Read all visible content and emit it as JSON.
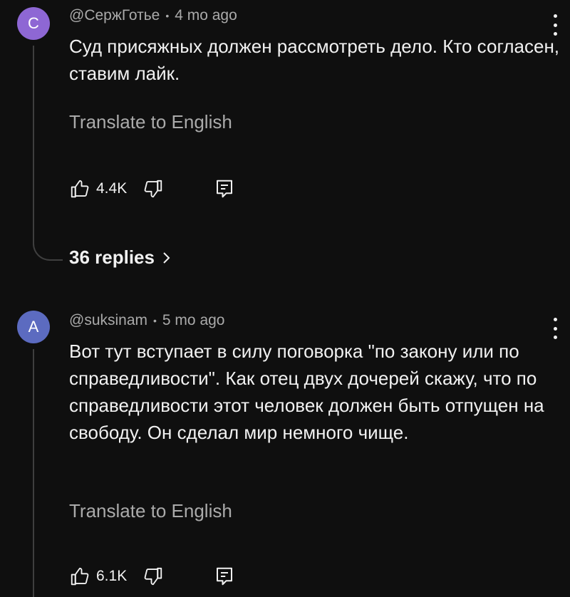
{
  "comments": [
    {
      "avatar_letter": "C",
      "avatar_color": "#8e67d4",
      "author": "@СержГотье",
      "separator": "•",
      "time": "4 mo ago",
      "text": "Суд присяжных должен рассмотреть дело. Кто согласен, ставим лайк.",
      "translate": "Translate to English",
      "likes": "4.4K",
      "replies_label": "36 replies"
    },
    {
      "avatar_letter": "A",
      "avatar_color": "#5c6bc0",
      "author": "@suksinam",
      "separator": "•",
      "time": "5 mo ago",
      "text": "Вот тут вступает в силу поговорка \"по закону или по справедливости\". Как отец двух дочерей скажу, что по справедливости этот человек должен быть отпущен на свободу. Он сделал мир немного чище.",
      "translate": "Translate to English",
      "likes": "6.1K"
    }
  ],
  "icons": {
    "like": "thumbs-up-icon",
    "dislike": "thumbs-down-icon",
    "reply": "reply-comment-icon",
    "more": "more-vertical-icon",
    "chevron": "chevron-right-icon"
  }
}
